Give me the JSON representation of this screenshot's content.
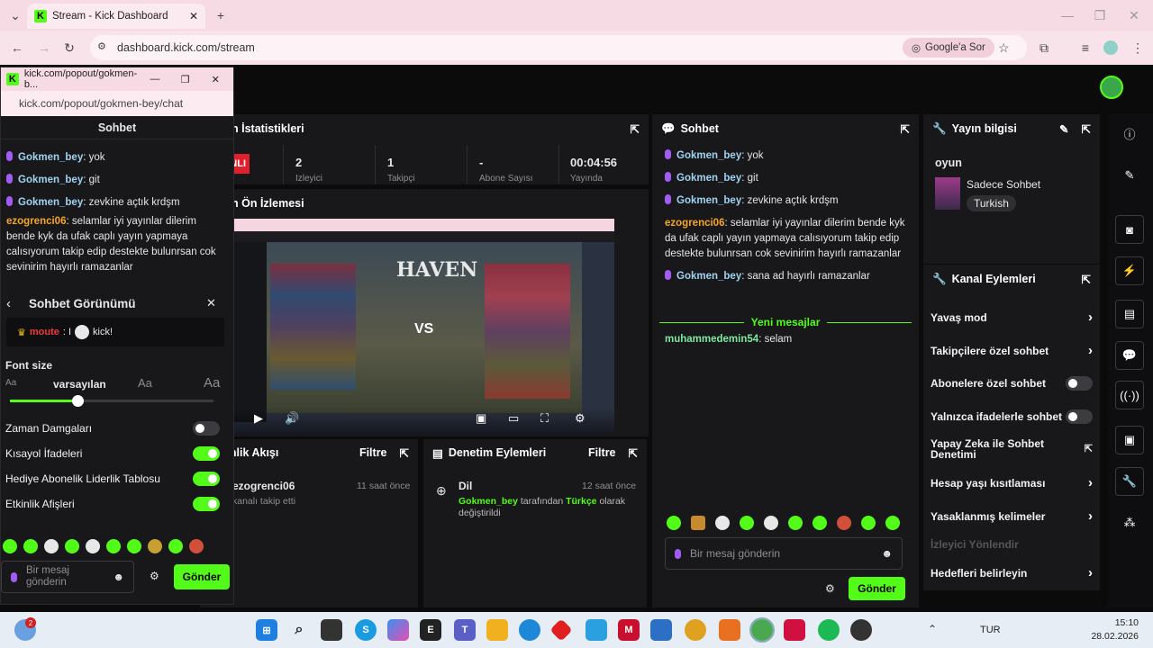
{
  "browser": {
    "tab_title": "Stream - Kick Dashboard",
    "url": "dashboard.kick.com/stream",
    "google_pill": "Google'a Sor",
    "new_tab": "+"
  },
  "popout": {
    "window_title": "kick.com/popout/gokmen-b...",
    "url": "kick.com/popout/gokmen-bey/chat",
    "header": "Sohbet",
    "messages": [
      {
        "user": "Gokmen_bey",
        "text": ": yok"
      },
      {
        "user": "Gokmen_bey",
        "text": ": git"
      },
      {
        "user": "Gokmen_bey",
        "text": ": zevkine açtık krdşm"
      },
      {
        "user": "ezogrenci06",
        "text": ": selamlar iyi yayınlar dilerim bende kyk da ufak caplı yayın yapmaya calısıyorum takip edip destekte bulunrsan cok sevinirim hayırlı ramazanlar"
      }
    ],
    "view_title": "Sohbet Görünümü",
    "preview_user": "moute",
    "preview_sep": ": I",
    "preview_text": "kick!",
    "font_size_label": "Font size",
    "font_small": "Aa",
    "font_default": "varsayılan",
    "font_medium": "Aa",
    "font_large": "Aa",
    "font_level": 0.33,
    "settings": [
      {
        "label": "Zaman Damgaları",
        "on": false
      },
      {
        "label": "Kısayol İfadeleri",
        "on": true
      },
      {
        "label": "Hediye Abonelik Liderlik Tablosu",
        "on": true
      },
      {
        "label": "Etkinlik Afişleri",
        "on": true
      }
    ],
    "input_placeholder": "Bir mesaj gönderin",
    "send": "Gönder"
  },
  "stats": {
    "title": "Yayın İstatistikleri",
    "badge": "CANLI",
    "values": [
      "2",
      "1",
      "-",
      "00:04:56"
    ],
    "labels": [
      "İzleyici",
      "Takipçi",
      "Abone Sayısı",
      "Yayında"
    ]
  },
  "preview": {
    "title": "Yayın Ön İzlemesi",
    "map": "HAVEN",
    "vs": "VS"
  },
  "activity": {
    "title": "Etkinlik Akışı",
    "filter": "Filtre",
    "user": "ezogrenci06",
    "time": "11 saat önce",
    "desc": "kanalı takip etti"
  },
  "moderation": {
    "title": "Denetim Eylemleri",
    "filter": "Filtre",
    "item_title": "Dil",
    "time": "12 saat önce",
    "user": "Gokmen_bey",
    "mid": "tarafından",
    "lang": "Türkçe",
    "tail": "olarak",
    "tail2": "değiştirildi"
  },
  "chat": {
    "title": "Sohbet",
    "messages": [
      {
        "user": "Gokmen_bey",
        "text": ": yok"
      },
      {
        "user": "Gokmen_bey",
        "text": ": git"
      },
      {
        "user": "Gokmen_bey",
        "text": ": zevkine açtık krdşm"
      },
      {
        "user": "ezogrenci06",
        "text": ": selamlar iyi yayınlar dilerim bende kyk da ufak caplı yayın yapmaya calısıyorum takip edip destekte bulunrsan cok sevinirim hayırlı ramazanlar"
      },
      {
        "user": "Gokmen_bey",
        "text": ": sana ad hayırlı ramazanlar"
      }
    ],
    "new_messages": "Yeni mesajlar",
    "new_msg": {
      "user": "muhammedemin54",
      "text": ": selam"
    },
    "input_placeholder": "Bir mesaj gönderin",
    "send": "Gönder"
  },
  "info": {
    "title": "Yayın bilgisi",
    "stream_title": "oyun",
    "category": "Sadece Sohbet",
    "language": "Turkish"
  },
  "actions": {
    "title": "Kanal Eylemleri",
    "items": [
      {
        "label": "Yavaş mod",
        "type": "chevron"
      },
      {
        "label": "Takipçilere özel sohbet",
        "type": "chevron"
      },
      {
        "label": "Abonelere özel sohbet",
        "type": "toggle"
      },
      {
        "label": "Yalnızca ifadelerle sohbet",
        "type": "toggle"
      },
      {
        "label": "Yapay Zeka ile Sohbet Denetimi",
        "type": "link"
      },
      {
        "label": "Hesap yaşı kısıtlaması",
        "type": "chevron"
      },
      {
        "label": "Yasaklanmış kelimeler",
        "type": "chevron"
      },
      {
        "label": "İzleyici Yönlendir",
        "type": "disabled"
      },
      {
        "label": "Hedefleri belirleyin",
        "type": "chevron"
      }
    ]
  },
  "taskbar": {
    "lang": "TUR",
    "time": "15:10",
    "date": "28.02.2026",
    "notif": "2"
  }
}
